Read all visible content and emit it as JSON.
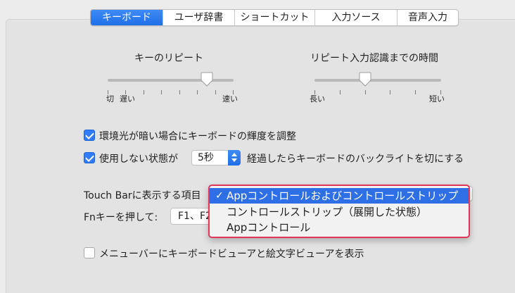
{
  "tabs": [
    "キーボード",
    "ユーザ辞書",
    "ショートカット",
    "入力ソース",
    "音声入力"
  ],
  "active_tab": "キーボード",
  "key_repeat": {
    "title": "キーのリピート",
    "label_off": "切",
    "label_slow": "遅い",
    "label_fast": "速い",
    "value_fraction": 0.79
  },
  "repeat_delay": {
    "title": "リピート入力認識までの時間",
    "label_long": "長い",
    "label_short": "短い",
    "value_fraction": 0.4
  },
  "options": {
    "ambient_light_label": "環境光が暗い場合にキーボードの輝度を調整",
    "ambient_light_checked": true,
    "backlight_prefix": "使用しない状態が",
    "backlight_value": "5秒",
    "backlight_suffix": "経過したらキーボードのバックライトを切にする",
    "backlight_checked": true,
    "viewer_label": "メニューバーにキーボードビューアと絵文字ビューアを表示",
    "viewer_checked": false
  },
  "touchbar": {
    "label": "Touch Barに表示する項目",
    "fn_label": "Fnキーを押して:",
    "fn_value": "F1、F2"
  },
  "dropdown": {
    "items": [
      "Appコントロールおよびコントロールストリップ",
      "コントロールストリップ（展開した状態）",
      "Appコントロール"
    ],
    "selected_index": 0,
    "check": "✓",
    "highlight_color": "#e0365a"
  }
}
